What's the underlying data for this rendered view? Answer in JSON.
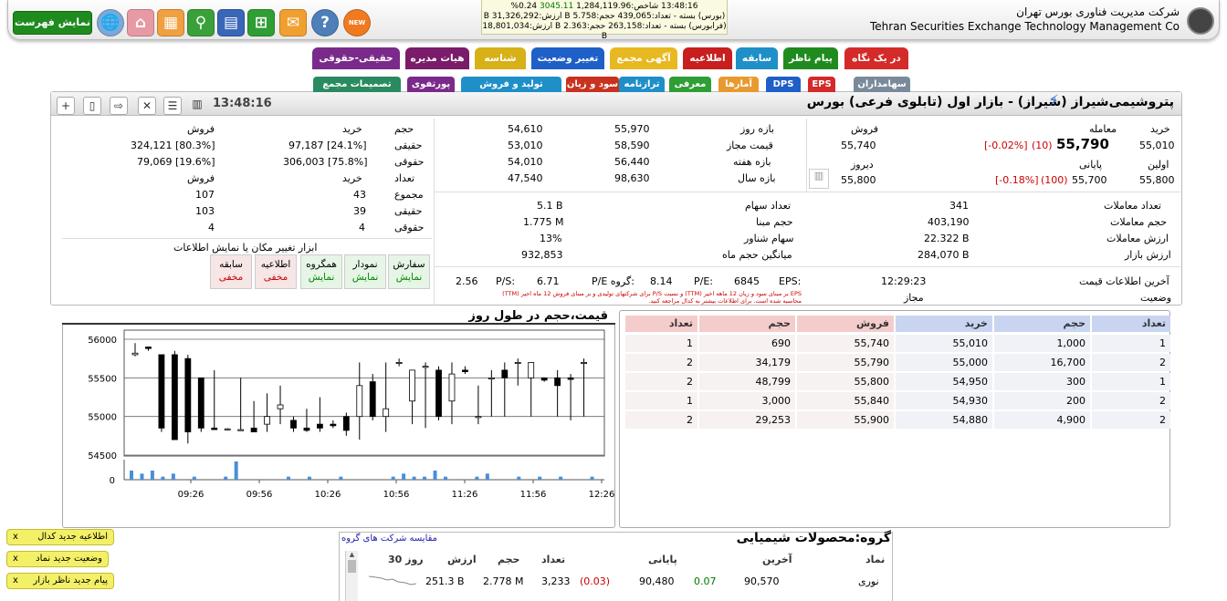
{
  "header": {
    "show_list_label": "نمایش فهرست",
    "new_badge": "NEW",
    "company_fa": "شرکت مدیریت فناوری بورس تهران",
    "company_en": "Tehran Securities Exchange Technology Management Co",
    "ticker": {
      "line1_time": "13:48:16",
      "line1_label": "شاخص:",
      "line1_value": "1,284,119.96",
      "line1_change": "3045.11",
      "line1_pct": "0.24%",
      "line2": "(بورس) بسته - تعداد:439,065 حجم:5.758 B ارزش:31,326,292 B",
      "line3": "(فرابورس) بسته - تعداد:263,158 حجم:2.363 B ارزش:18,801,034 B"
    }
  },
  "tabs_top": [
    "در یک نگاه",
    "پیام ناظر",
    "سابقه",
    "اطلاعیه",
    "آگهی مجمع",
    "تغییر وضعیت",
    "شناسه",
    "هیات مدیره",
    "حقیقی-حقوقی"
  ],
  "tabs_bottom": [
    "EPS",
    "DPS",
    "آمارها",
    "معرفی",
    "ترازنامه",
    "سود و زیان",
    "تولید و فروش",
    "پورتفوی",
    "تصمیمات مجمع",
    "سهامداران"
  ],
  "main": {
    "title": "پتروشیمی‌شیراز (شیراز) - بازار اول (تابلوی فرعی) بورس",
    "time": "13:48:16",
    "price": {
      "buy_label": "خرید",
      "buy": "55,010",
      "trade_label": "معامله",
      "trade": "55,790",
      "trade_vol": "(10)",
      "trade_pct": "[-0.02%]",
      "sell_label": "فروش",
      "sell": "55,740",
      "first_label": "اولین",
      "first": "55,800",
      "close_label": "پایانی",
      "close": "55,700",
      "close_vol": "(100)",
      "close_pct": "[-0.18%]",
      "yesterday_label": "دیروز",
      "yesterday": "55,800"
    },
    "ranges": {
      "day_label": "بازه روز",
      "day_low": "54,610",
      "day_high": "55,970",
      "allowed_label": "قیمت مجاز",
      "allowed_low": "53,010",
      "allowed_high": "58,590",
      "week_label": "بازه هفته",
      "week_low": "54,010",
      "week_high": "56,440",
      "year_label": "بازه سال",
      "year_low": "47,540",
      "year_high": "98,630"
    },
    "stats": {
      "trades_count_label": "تعداد معاملات",
      "trades_count": "341",
      "trades_vol_label": "حجم معاملات",
      "trades_vol": "403,190",
      "trades_value_label": "ارزش معاملات",
      "trades_value": "22.322 B",
      "market_value_label": "ارزش بازار",
      "market_value": "284,070 B",
      "shares_label": "تعداد سهام",
      "shares": "5.1 B",
      "base_vol_label": "حجم مبنا",
      "base_vol": "1.775 M",
      "float_label": "سهام شناور",
      "float": "13%",
      "month_avg_label": "میانگین حجم ماه",
      "month_avg": "932,853"
    },
    "ratios": {
      "eps_label": "EPS:",
      "eps": "6845",
      "pe_label": "P/E:",
      "pe": "8.14",
      "gpe_label": "P/E گروه:",
      "gpe": "6.71",
      "ps_label": "P/S:",
      "ps": "2.56",
      "note1": "EPS بر مبنای سود و زیان 12 ماهه اخیر (TTM) و نسبت P/S برای شرکتهای تولیدی و بر مبنای فروش 12 ماه اخیر (TTM)",
      "note2": "محاسبه شده است. برای اطلاعات بیشتر به کدال مراجعه کنید."
    },
    "status": {
      "last_info_label": "آخرین اطلاعات قیمت",
      "last_info": "12:29:23",
      "state_label": "وضعیت",
      "state": "مجاز"
    },
    "legal": {
      "h_vol": "حجم",
      "h_buy": "خرید",
      "h_sell": "فروش",
      "real_label": "حقیقی",
      "legal_label": "حقوقی",
      "real_buy": "97,187 [24.1%]",
      "real_sell": "324,121 [80.3%]",
      "legal_buy": "306,003 [75.8%]",
      "legal_sell": "79,069 [19.6%]",
      "h_count": "تعداد",
      "total_label": "مجموع",
      "total_buy": "43",
      "total_sell": "107",
      "real_buy_n": "39",
      "real_sell_n": "103",
      "legal_buy_n": "4",
      "legal_sell_n": "4"
    },
    "tools_label": "ابزار تغییر مکان یا نمایش اطلاعات",
    "tools": [
      {
        "name": "سفارش",
        "state": "نمایش",
        "on": true
      },
      {
        "name": "نمودار",
        "state": "نمایش",
        "on": true
      },
      {
        "name": "همگروه",
        "state": "نمایش",
        "on": true
      },
      {
        "name": "اطلاعیه",
        "state": "مخفی",
        "on": false
      },
      {
        "name": "سابقه",
        "state": "مخفی",
        "on": false
      }
    ]
  },
  "chart_data": {
    "type": "candlestick",
    "title": "قیمت،حجم در طول روز",
    "y_ticks": [
      "56000",
      "55500",
      "55000",
      "54500"
    ],
    "ylim": [
      54500,
      56000
    ],
    "x_ticks": [
      "09:26",
      "09:56",
      "10:26",
      "10:56",
      "11:26",
      "11:56",
      "12:26"
    ],
    "vol_tick": "0",
    "candles": [
      {
        "o": 55800,
        "h": 55950,
        "l": 55780,
        "c": 55820
      },
      {
        "o": 55900,
        "h": 55900,
        "l": 55850,
        "c": 55880
      },
      {
        "o": 55800,
        "h": 55800,
        "l": 54800,
        "c": 54850
      },
      {
        "o": 55800,
        "h": 55850,
        "l": 54700,
        "c": 54700
      },
      {
        "o": 55750,
        "h": 55800,
        "l": 54650,
        "c": 54800
      },
      {
        "o": 55500,
        "h": 55500,
        "l": 54800,
        "c": 54850
      },
      {
        "o": 54850,
        "h": 55600,
        "l": 54850,
        "c": 54830
      },
      {
        "o": 54830,
        "h": 54850,
        "l": 54820,
        "c": 54840
      },
      {
        "o": 54820,
        "h": 55500,
        "l": 54820,
        "c": 54830
      },
      {
        "o": 54850,
        "h": 55200,
        "l": 54800,
        "c": 54800
      },
      {
        "o": 54900,
        "h": 55300,
        "l": 54800,
        "c": 55000
      },
      {
        "o": 55100,
        "h": 55400,
        "l": 54900,
        "c": 55150
      },
      {
        "o": 54950,
        "h": 55000,
        "l": 54800,
        "c": 54850
      },
      {
        "o": 54850,
        "h": 55100,
        "l": 54800,
        "c": 54820
      },
      {
        "o": 54900,
        "h": 55250,
        "l": 54800,
        "c": 54850
      },
      {
        "o": 54900,
        "h": 54950,
        "l": 54850,
        "c": 54880
      },
      {
        "o": 55000,
        "h": 55050,
        "l": 54750,
        "c": 54820
      },
      {
        "o": 55000,
        "h": 55700,
        "l": 54700,
        "c": 55400
      },
      {
        "o": 55450,
        "h": 55550,
        "l": 54950,
        "c": 55000
      },
      {
        "o": 55000,
        "h": 55700,
        "l": 54800,
        "c": 55100
      },
      {
        "o": 55700,
        "h": 55750,
        "l": 55650,
        "c": 55700
      },
      {
        "o": 55200,
        "h": 55600,
        "l": 54900,
        "c": 55600
      },
      {
        "o": 55650,
        "h": 55700,
        "l": 54850,
        "c": 55650
      },
      {
        "o": 55600,
        "h": 55650,
        "l": 54950,
        "c": 55000
      },
      {
        "o": 55200,
        "h": 55700,
        "l": 54900,
        "c": 55550
      },
      {
        "o": 55600,
        "h": 55650,
        "l": 55550,
        "c": 55580
      },
      {
        "o": 55000,
        "h": 55400,
        "l": 54900,
        "c": 55000
      },
      {
        "o": 55500,
        "h": 55600,
        "l": 55000,
        "c": 55500
      },
      {
        "o": 55600,
        "h": 55700,
        "l": 55000,
        "c": 55500
      },
      {
        "o": 55700,
        "h": 55750,
        "l": 55400,
        "c": 55700
      },
      {
        "o": 55500,
        "h": 55700,
        "l": 55000,
        "c": 55700
      },
      {
        "o": 55500,
        "h": 55500,
        "l": 55450,
        "c": 55470
      },
      {
        "o": 55500,
        "h": 55600,
        "l": 55000,
        "c": 55400
      },
      {
        "o": 55500,
        "h": 55550,
        "l": 54950,
        "c": 55480
      },
      {
        "o": 55700,
        "h": 55750,
        "l": 55000,
        "c": 55700
      }
    ],
    "volumes": [
      3,
      2,
      3,
      1,
      2,
      0,
      1,
      0,
      0,
      1,
      6,
      0,
      0,
      0,
      0,
      1,
      0,
      1,
      0,
      0,
      1,
      0,
      0,
      0,
      0,
      1,
      2,
      1,
      1,
      3,
      1,
      0,
      0,
      1,
      2,
      0,
      0,
      1,
      0,
      1,
      0,
      1,
      0,
      0,
      1
    ]
  },
  "orderbook": {
    "headers": [
      "تعداد",
      "حجم",
      "خرید",
      "فروش",
      "حجم",
      "تعداد"
    ],
    "rows": [
      [
        "1",
        "1,000",
        "55,010",
        "55,740",
        "690",
        "1"
      ],
      [
        "2",
        "16,700",
        "55,000",
        "55,790",
        "34,179",
        "2"
      ],
      [
        "1",
        "300",
        "54,950",
        "55,800",
        "48,799",
        "2"
      ],
      [
        "2",
        "200",
        "54,930",
        "55,840",
        "3,000",
        "1"
      ],
      [
        "2",
        "4,900",
        "54,880",
        "55,900",
        "29,253",
        "2"
      ]
    ]
  },
  "notices": [
    "اطلاعیه جدید کدال",
    "وضعیت جدید نماد",
    "پیام جدید ناظر بازار"
  ],
  "group": {
    "title": "گروه:محصولات شیمیایی",
    "compare_link": "مقایسه شرکت های گروه",
    "headers": [
      "نماد",
      "آخرین",
      "",
      "پایانی",
      "",
      "تعداد",
      "حجم",
      "ارزش",
      "30 روز"
    ],
    "row": {
      "symbol": "نوری",
      "last": "90,570",
      "last_chg": "0.07",
      "close": "90,480",
      "close_chg": "(0.03)",
      "count": "3,233",
      "vol": "2.778 M",
      "value": "251.3 B"
    }
  },
  "colors": {
    "accent_green": "#1f8b1f",
    "sell_red": "#c00",
    "volume_blue": "#4a8fd8"
  }
}
